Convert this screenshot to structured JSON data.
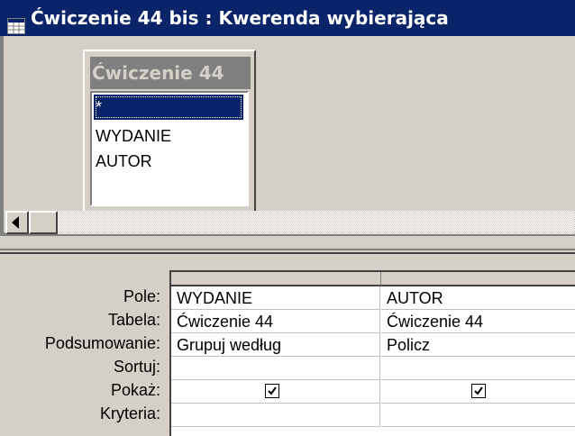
{
  "window": {
    "title": "Ćwiczenie 44 bis : Kwerenda wybierająca",
    "icon": "query-datasheet-icon"
  },
  "table_box": {
    "title": "Ćwiczenie 44",
    "fields": [
      "*",
      "WYDANIE",
      "AUTOR"
    ],
    "selected_field": "*"
  },
  "row_labels": {
    "field": "Pole:",
    "table": "Tabela:",
    "total": "Podsumowanie:",
    "sort": "Sortuj:",
    "show": "Pokaż:",
    "criteria": "Kryteria:"
  },
  "columns": [
    {
      "field": "WYDANIE",
      "table": "Ćwiczenie 44",
      "total": "Grupuj według",
      "sort": "",
      "show": true,
      "criteria": ""
    },
    {
      "field": "AUTOR",
      "table": "Ćwiczenie 44",
      "total": "Policz",
      "sort": "",
      "show": true,
      "criteria": ""
    }
  ],
  "colors": {
    "title_bar": "#0a246a",
    "selection": "#0a246a",
    "face": "#d4d0c8"
  }
}
